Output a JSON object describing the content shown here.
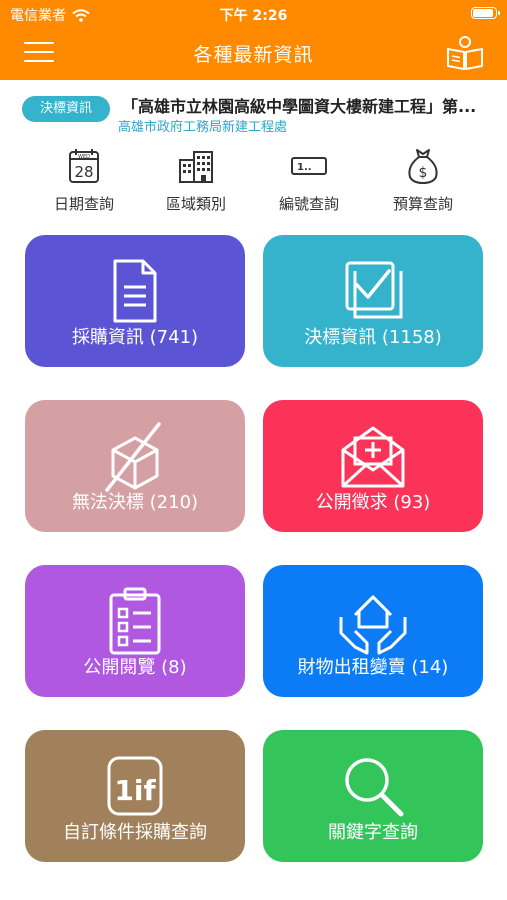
{
  "status_bar": {
    "carrier": "電信業者",
    "time": "下午 2:26",
    "battery_level": 0.95
  },
  "navbar": {
    "title": "各種最新資訊",
    "icons": [
      "menu-icon",
      "reading-book-icon"
    ]
  },
  "news": {
    "badge": "決標資訊",
    "title": "「高雄市立林園高級中學圖資大樓新建工程」第...",
    "org": "高雄市政府工務局新建工程處"
  },
  "quick_links": [
    {
      "label": "日期查詢",
      "icon": "calendar-icon",
      "day_label": "WED",
      "day_number": "28"
    },
    {
      "label": "區域類別",
      "icon": "buildings-icon"
    },
    {
      "label": "編號查詢",
      "icon": "serial-number-icon",
      "number_text": "1.."
    },
    {
      "label": "預算查詢",
      "icon": "money-bag-icon",
      "symbol": "$"
    }
  ],
  "tiles": [
    {
      "label": "採購資訊 (741)",
      "icon": "document-icon",
      "color": "#5b55d6"
    },
    {
      "label": "決標資訊 (1158)",
      "icon": "checkbox-icon",
      "color": "#35b2cc"
    },
    {
      "label": "無法決標 (210)",
      "icon": "crossed-box-icon",
      "color": "#d4a0a3"
    },
    {
      "label": "公開徵求 (93)",
      "icon": "envelope-icon",
      "color": "#fb3358"
    },
    {
      "label": "公開閱覽 (8)",
      "icon": "clipboard-icon",
      "color": "#b158e0"
    },
    {
      "label": "財物出租變賣 (14)",
      "icon": "house-hands-icon",
      "color": "#0b7cf6"
    },
    {
      "label": "自訂條件採購查詢",
      "icon": "one-if-icon",
      "one_if_text": "1if",
      "color": "#a1815b"
    },
    {
      "label": "關鍵字查詢",
      "icon": "magnifier-icon",
      "color": "#33c45a"
    }
  ]
}
